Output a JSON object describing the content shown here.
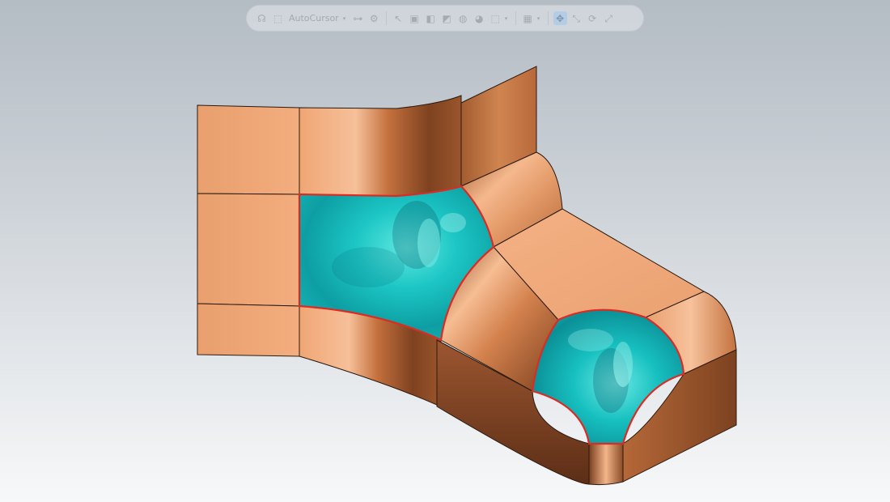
{
  "toolbar": {
    "items": [
      {
        "type": "button",
        "name": "headset-icon",
        "glyph": "☊"
      },
      {
        "type": "button",
        "name": "cursor-select-icon",
        "glyph": "⬚"
      },
      {
        "type": "label",
        "text": "AutoCursor"
      },
      {
        "type": "caret",
        "name": "autocursor-dropdown-icon"
      },
      {
        "type": "button",
        "name": "hierarchy-icon",
        "glyph": "⊶"
      },
      {
        "type": "button",
        "name": "gear-icon",
        "glyph": "⚙"
      },
      {
        "type": "sep"
      },
      {
        "type": "button",
        "name": "arrow-pointer-icon",
        "glyph": "↖"
      },
      {
        "type": "button",
        "name": "cube-select-icon",
        "glyph": "▣"
      },
      {
        "type": "button",
        "name": "box-select-icon",
        "glyph": "◧"
      },
      {
        "type": "button",
        "name": "shape-select-icon",
        "glyph": "◩"
      },
      {
        "type": "button",
        "name": "sphere-icon",
        "glyph": "◍"
      },
      {
        "type": "button",
        "name": "body-color-icon",
        "glyph": "◕"
      },
      {
        "type": "button",
        "name": "frame-select-icon",
        "glyph": "⬚"
      },
      {
        "type": "caret",
        "name": "select-dropdown-icon"
      },
      {
        "type": "sep"
      },
      {
        "type": "button",
        "name": "grid-view-icon",
        "glyph": "▦"
      },
      {
        "type": "caret",
        "name": "view-dropdown-icon"
      },
      {
        "type": "sep"
      },
      {
        "type": "button",
        "name": "pan-icon",
        "glyph": "✥",
        "active": true
      },
      {
        "type": "button",
        "name": "zoom-box-icon",
        "glyph": "⤡"
      },
      {
        "type": "button",
        "name": "rotate-icon",
        "glyph": "⟳"
      },
      {
        "type": "button",
        "name": "fit-view-icon",
        "glyph": "⤢"
      }
    ]
  },
  "colors": {
    "copper_light": "#f1a979",
    "copper_mid": "#db8b59",
    "copper_dark": "#8a4a26",
    "copper_shadow": "#5e2f17",
    "patch_cyan": "#1fc8c6",
    "patch_cyan_dark": "#0e8f96",
    "patch_border": "#dd2a22",
    "edge_line": "#2a1a10"
  }
}
